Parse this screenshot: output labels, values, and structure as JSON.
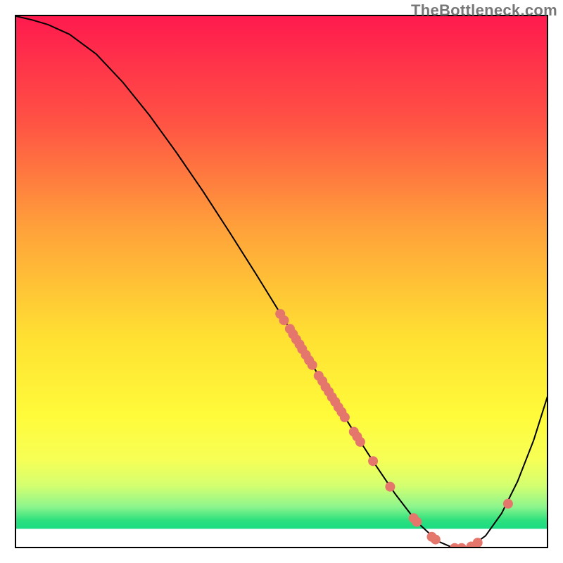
{
  "attribution": "TheBottleneck.com",
  "chart_data": {
    "type": "line",
    "title": "",
    "xlabel": "",
    "ylabel": "",
    "xlim": [
      0,
      100
    ],
    "ylim": [
      0,
      100
    ],
    "grid": false,
    "legend": false,
    "background": "vertical-gradient red→orange→yellow→green with thin white bottom band",
    "series": [
      {
        "name": "curve",
        "type": "line",
        "color": "#000000",
        "x": [
          0,
          3,
          6,
          10,
          15,
          20,
          25,
          30,
          35,
          40,
          45,
          50,
          55,
          60,
          63,
          67,
          71,
          75,
          79,
          82,
          85,
          88,
          91,
          94,
          97,
          100
        ],
        "y": [
          100,
          99.3,
          98.4,
          96.6,
          92.9,
          87.6,
          81.4,
          74.5,
          67.2,
          59.5,
          51.6,
          43.5,
          35.4,
          27.4,
          22.6,
          16.4,
          10.5,
          5.3,
          1.6,
          0.3,
          0.4,
          2.6,
          6.8,
          12.8,
          20.5,
          30.0
        ]
      },
      {
        "name": "cluster-points",
        "type": "scatter",
        "color": "#e5766c",
        "points": [
          {
            "x": 49.5,
            "y": 44.2
          },
          {
            "x": 50.2,
            "y": 43.0
          },
          {
            "x": 51.3,
            "y": 41.4
          },
          {
            "x": 51.9,
            "y": 40.4
          },
          {
            "x": 52.5,
            "y": 39.4
          },
          {
            "x": 53.1,
            "y": 38.5
          },
          {
            "x": 53.6,
            "y": 37.6
          },
          {
            "x": 54.3,
            "y": 36.5
          },
          {
            "x": 54.9,
            "y": 35.5
          },
          {
            "x": 55.5,
            "y": 34.6
          },
          {
            "x": 56.7,
            "y": 32.6
          },
          {
            "x": 57.4,
            "y": 31.6
          },
          {
            "x": 58.0,
            "y": 30.5
          },
          {
            "x": 58.6,
            "y": 29.6
          },
          {
            "x": 59.2,
            "y": 28.6
          },
          {
            "x": 59.8,
            "y": 27.7
          },
          {
            "x": 60.4,
            "y": 26.7
          },
          {
            "x": 61.0,
            "y": 25.8
          },
          {
            "x": 61.6,
            "y": 24.8
          },
          {
            "x": 63.3,
            "y": 22.1
          },
          {
            "x": 63.9,
            "y": 21.2
          },
          {
            "x": 64.5,
            "y": 20.2
          },
          {
            "x": 66.9,
            "y": 16.6
          },
          {
            "x": 70.1,
            "y": 11.8
          },
          {
            "x": 74.5,
            "y": 5.9
          },
          {
            "x": 75.1,
            "y": 5.2
          },
          {
            "x": 77.9,
            "y": 2.4
          },
          {
            "x": 78.6,
            "y": 1.9
          },
          {
            "x": 82.2,
            "y": 0.3
          },
          {
            "x": 83.5,
            "y": 0.3
          },
          {
            "x": 85.3,
            "y": 0.6
          },
          {
            "x": 86.5,
            "y": 1.3
          },
          {
            "x": 92.2,
            "y": 8.6
          }
        ]
      }
    ],
    "gradient_stops": [
      {
        "offset": 0.0,
        "color": "#ff1a4e"
      },
      {
        "offset": 0.2,
        "color": "#ff5344"
      },
      {
        "offset": 0.4,
        "color": "#ffa23a"
      },
      {
        "offset": 0.6,
        "color": "#ffe032"
      },
      {
        "offset": 0.75,
        "color": "#fffb3a"
      },
      {
        "offset": 0.83,
        "color": "#f7ff55"
      },
      {
        "offset": 0.88,
        "color": "#d4ff70"
      },
      {
        "offset": 0.92,
        "color": "#8cf58d"
      },
      {
        "offset": 0.945,
        "color": "#2de07d"
      },
      {
        "offset": 0.96,
        "color": "#1bdc83"
      },
      {
        "offset": 0.962,
        "color": "#ffffff"
      },
      {
        "offset": 1.0,
        "color": "#ffffff"
      }
    ]
  }
}
